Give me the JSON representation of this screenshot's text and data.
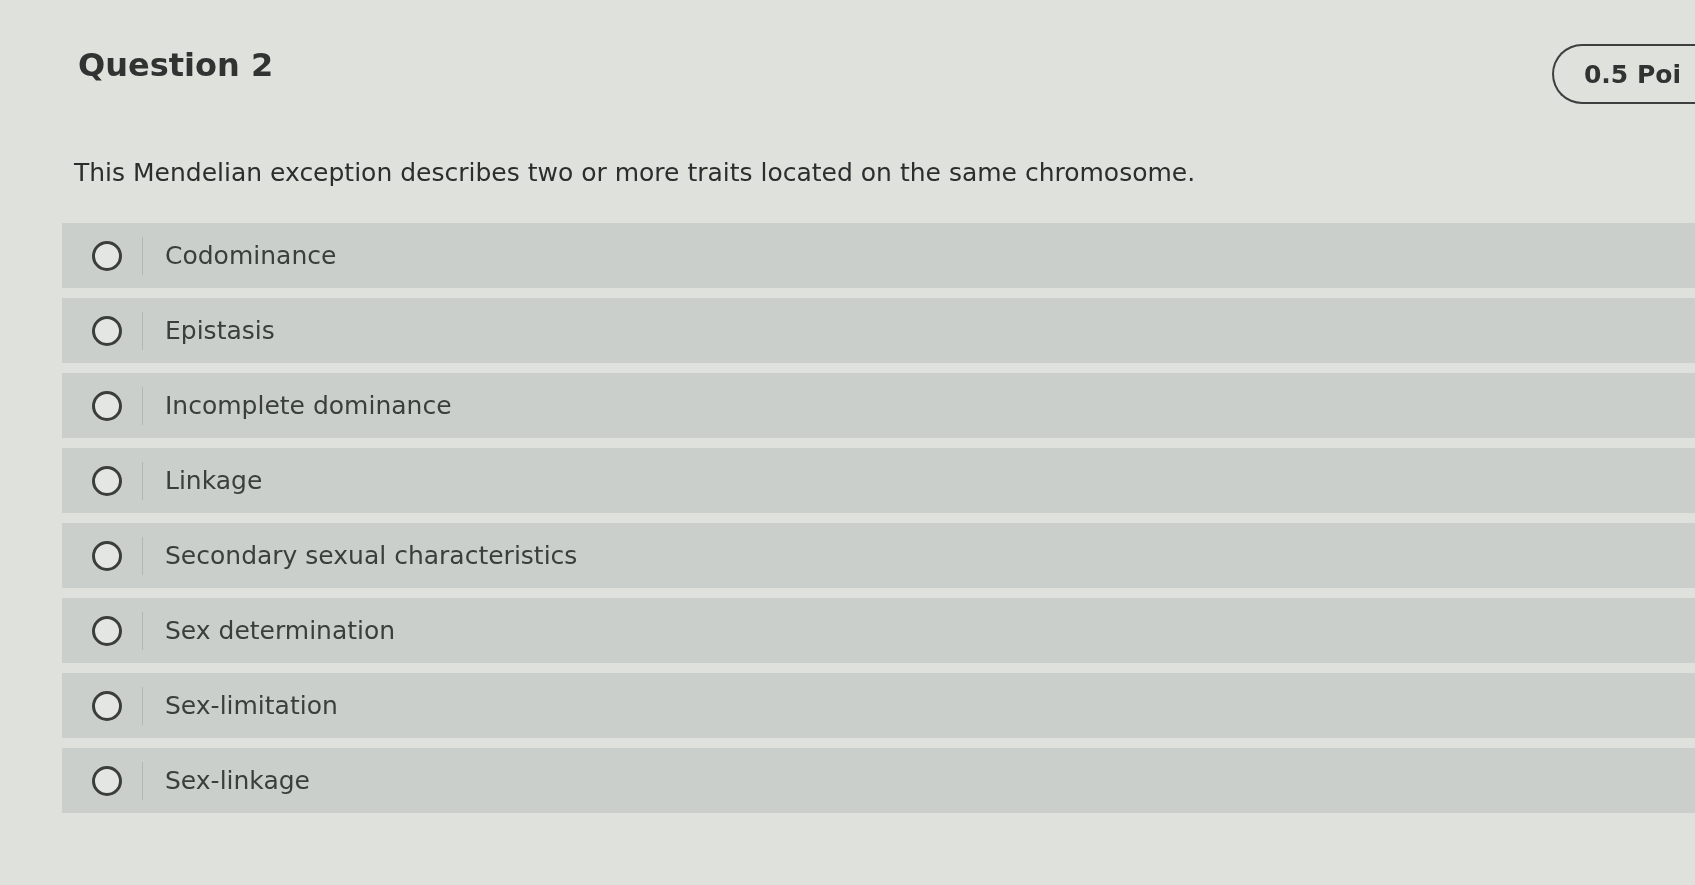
{
  "question": {
    "title": "Question 2",
    "points": "0.5 Poi",
    "prompt": "This Mendelian exception describes two or more traits located on the same chromosome."
  },
  "options": [
    {
      "label": "Codominance",
      "selected": false
    },
    {
      "label": "Epistasis",
      "selected": false
    },
    {
      "label": "Incomplete dominance",
      "selected": false
    },
    {
      "label": "Linkage",
      "selected": false
    },
    {
      "label": "Secondary sexual characteristics",
      "selected": false
    },
    {
      "label": "Sex determination",
      "selected": false
    },
    {
      "label": "Sex-limitation",
      "selected": false
    },
    {
      "label": "Sex-linkage",
      "selected": false
    }
  ]
}
